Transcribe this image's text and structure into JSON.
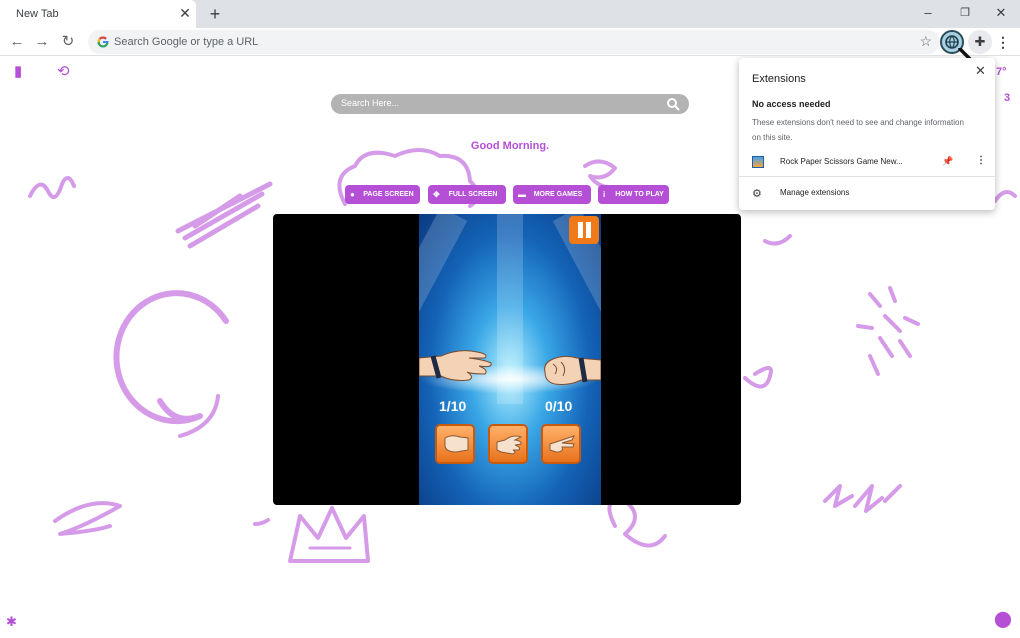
{
  "tab": {
    "title": "New Tab",
    "close": "✕",
    "new_tab": "+"
  },
  "window_controls": {
    "minimize": "–",
    "restore": "❐",
    "close": "✕"
  },
  "omnibox": {
    "placeholder": "Search Google or type a URL"
  },
  "page": {
    "search_placeholder": "Search Here...",
    "greeting": "Good Morning.",
    "buttons": [
      {
        "label": "PAGE SCREEN",
        "icon": "bulb-icon"
      },
      {
        "label": "FULL SCREEN",
        "icon": "move-icon"
      },
      {
        "label": "MORE GAMES",
        "icon": "gamepad-icon"
      },
      {
        "label": "HOW TO PLAY",
        "icon": "info-icon"
      }
    ],
    "weather_peek": [
      "7°",
      "3"
    ],
    "accent_color": "#b44fd6"
  },
  "game": {
    "player_score": "1/10",
    "opponent_score": "0/10",
    "choices": [
      "rock",
      "paper",
      "scissors"
    ],
    "gradient_colors": [
      "#b6f2ff",
      "#3aa7e6",
      "#0a3a80"
    ],
    "button_color": "#f07a1a"
  },
  "extensions_popup": {
    "title": "Extensions",
    "close": "✕",
    "subtitle": "No access needed",
    "description": "These extensions don't need to see and change information on this site.",
    "extension_name": "Rock Paper Scissors Game New...",
    "manage_label": "Manage extensions"
  }
}
